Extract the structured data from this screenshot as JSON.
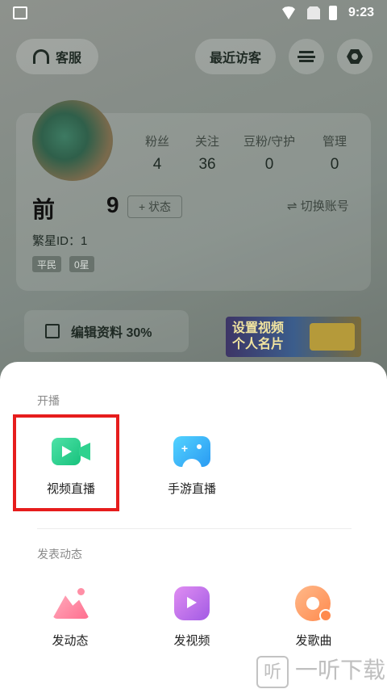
{
  "status_bar": {
    "time": "9:23"
  },
  "header": {
    "service_label": "客服",
    "visitors_label": "最近访客"
  },
  "profile": {
    "stats": [
      {
        "label": "粉丝",
        "value": "4"
      },
      {
        "label": "关注",
        "value": "36"
      },
      {
        "label": "豆粉/守护",
        "value": "0"
      },
      {
        "label": "管理",
        "value": "0"
      }
    ],
    "nickname_start": "前",
    "nickname_end": "9",
    "status_button": "+ 状态",
    "switch_account": "⇌ 切换账号",
    "fanstar_id": "繁星ID：1 ",
    "tags": [
      "平民",
      "0星"
    ],
    "edit_profile": "编辑资料 30%",
    "promo_line1": "设置视频",
    "promo_line2": "个人名片"
  },
  "sheet": {
    "live_section": "开播",
    "live_items": [
      {
        "label": "视频直播",
        "icon": "video-camera-icon"
      },
      {
        "label": "手游直播",
        "icon": "gamepad-icon"
      }
    ],
    "post_section": "发表动态",
    "post_items": [
      {
        "label": "发动态",
        "icon": "image-post-icon"
      },
      {
        "label": "发视频",
        "icon": "video-play-icon"
      },
      {
        "label": "发歌曲",
        "icon": "music-disc-icon"
      }
    ]
  },
  "watermark": {
    "logo": "听",
    "text": "一听下载"
  },
  "colors": {
    "highlight": "#e61d1d",
    "video_green": "#18c27d",
    "game_blue": "#2a9af2"
  }
}
